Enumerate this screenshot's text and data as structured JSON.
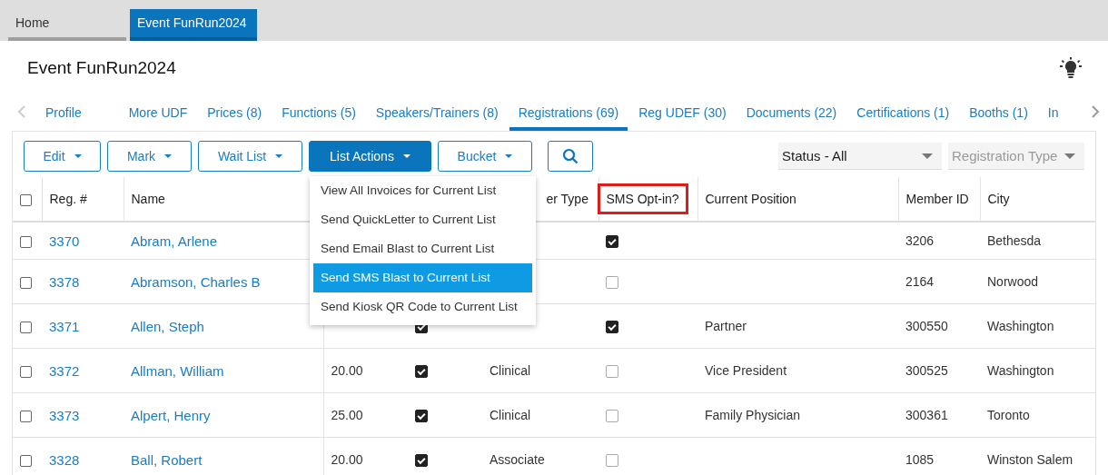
{
  "app_tabs": [
    {
      "label": "Home",
      "selected": false
    },
    {
      "label": "Event FunRun2024",
      "selected": true
    }
  ],
  "page_title": "Event FunRun2024",
  "section_tabs": [
    {
      "label": "Profile",
      "selected": false
    },
    {
      "label": "More UDF",
      "selected": false
    },
    {
      "label": "Prices (8)",
      "selected": false
    },
    {
      "label": "Functions (5)",
      "selected": false
    },
    {
      "label": "Speakers/Trainers (8)",
      "selected": false
    },
    {
      "label": "Registrations (69)",
      "selected": true
    },
    {
      "label": "Reg UDEF (30)",
      "selected": false
    },
    {
      "label": "Documents (22)",
      "selected": false
    },
    {
      "label": "Certifications (1)",
      "selected": false
    },
    {
      "label": "Booths (1)",
      "selected": false
    },
    {
      "label": "In",
      "selected": false
    }
  ],
  "toolbar_buttons": [
    {
      "label": "Edit",
      "selected": false
    },
    {
      "label": "Mark",
      "selected": false
    },
    {
      "label": "Wait List",
      "selected": false
    },
    {
      "label": "List Actions",
      "selected": true
    },
    {
      "label": "Bucket",
      "selected": false
    }
  ],
  "filters": [
    {
      "value": "Status - All"
    },
    {
      "placeholder": "Registration Type"
    }
  ],
  "list_actions_menu": [
    {
      "label": "View All Invoices for Current List",
      "selected": false
    },
    {
      "label": "Send QuickLetter to Current List",
      "selected": false
    },
    {
      "label": "Send Email Blast to Current List",
      "selected": false
    },
    {
      "label": "Send SMS Blast to Current List",
      "selected": true
    },
    {
      "label": "Send Kiosk QR Code to Current List",
      "selected": false
    }
  ],
  "table": {
    "select_all": {
      "checked": false
    },
    "columns": [
      {
        "label": "Reg. #",
        "highlighted": false
      },
      {
        "label": "Name",
        "highlighted": false
      },
      {
        "label": "er Type",
        "highlighted": false
      },
      {
        "label": "SMS Opt-in?",
        "highlighted": true
      },
      {
        "label": "Current Position",
        "highlighted": false
      },
      {
        "label": "Member ID",
        "highlighted": false
      },
      {
        "label": "City",
        "highlighted": false
      }
    ],
    "rows": [
      {
        "selected": false,
        "reg": "3370",
        "name": "Abram, Arlene",
        "sms": true,
        "member_id": "3206",
        "city": "Bethesda"
      },
      {
        "selected": false,
        "reg": "3378",
        "name": "Abramson, Charles B",
        "sms": false,
        "member_id": "2164",
        "city": "Norwood"
      },
      {
        "selected": false,
        "reg": "3371",
        "name": "Allen, Steph",
        "paid": true,
        "sms": true,
        "position": "Partner",
        "member_id": "300550",
        "city": "Washington"
      },
      {
        "selected": false,
        "reg": "3372",
        "name": "Allman, William",
        "amount": "20.00",
        "paid": true,
        "type": "Clinical",
        "sms": false,
        "position": "Vice President",
        "member_id": "300525",
        "city": "Washington"
      },
      {
        "selected": false,
        "reg": "3373",
        "name": "Alpert, Henry",
        "amount": "25.00",
        "paid": true,
        "type": "Clinical",
        "sms": false,
        "position": "Family Physician",
        "member_id": "300361",
        "city": "Toronto"
      },
      {
        "selected": false,
        "reg": "3328",
        "name": "Ball, Robert",
        "amount": "20.00",
        "paid": true,
        "type": "Associate",
        "sms": false,
        "member_id": "1085",
        "city": "Winston Salem"
      }
    ]
  }
}
